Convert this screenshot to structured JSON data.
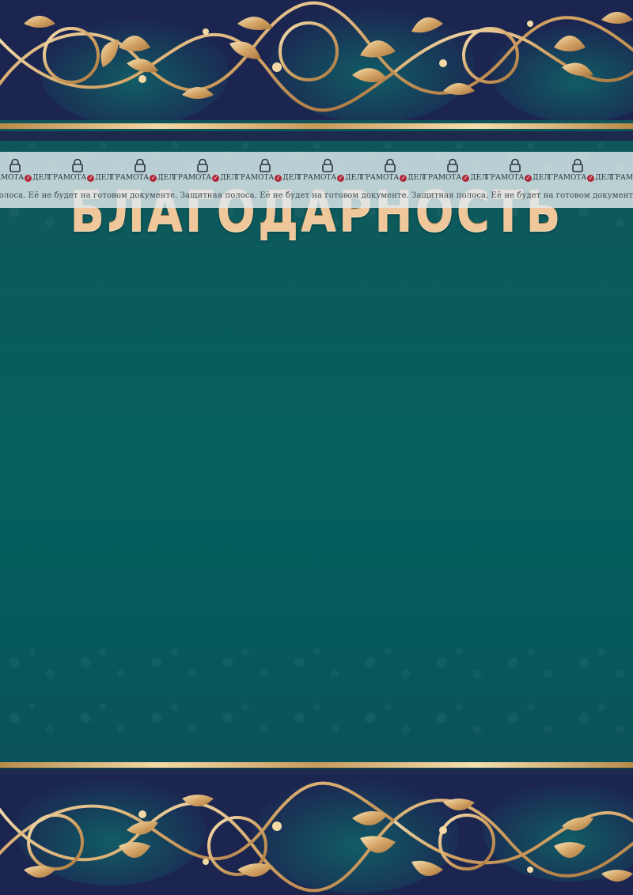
{
  "title": "БЛАГОДАРНОСТЬ",
  "watermark": {
    "brand_left": "ГРАМОТА",
    "brand_right": "ДЕЛ",
    "notice": "Защитная полоса. Её не будет на готовом документе. Защитная полоса. Её не будет на готовом документе. Защитная полоса. Её не будет на готовом документе. Защитная полоса. Её не будет на готовом документе.",
    "notice_visible": "полоса. Её не будет на готовом документе. Защитная полоса. Её не будет на готовом документе. Защитная полоса. Её не будет на готовом документе. Защитная полоса. Её не будет на готов",
    "logo_count": 11
  },
  "colors": {
    "background": "#04605d",
    "band": "#1c2450",
    "gold": "#e3bb82",
    "rule_dark": "#1c2a4c"
  },
  "icons": {
    "lock": "lock-icon",
    "check": "check-badge-icon"
  }
}
